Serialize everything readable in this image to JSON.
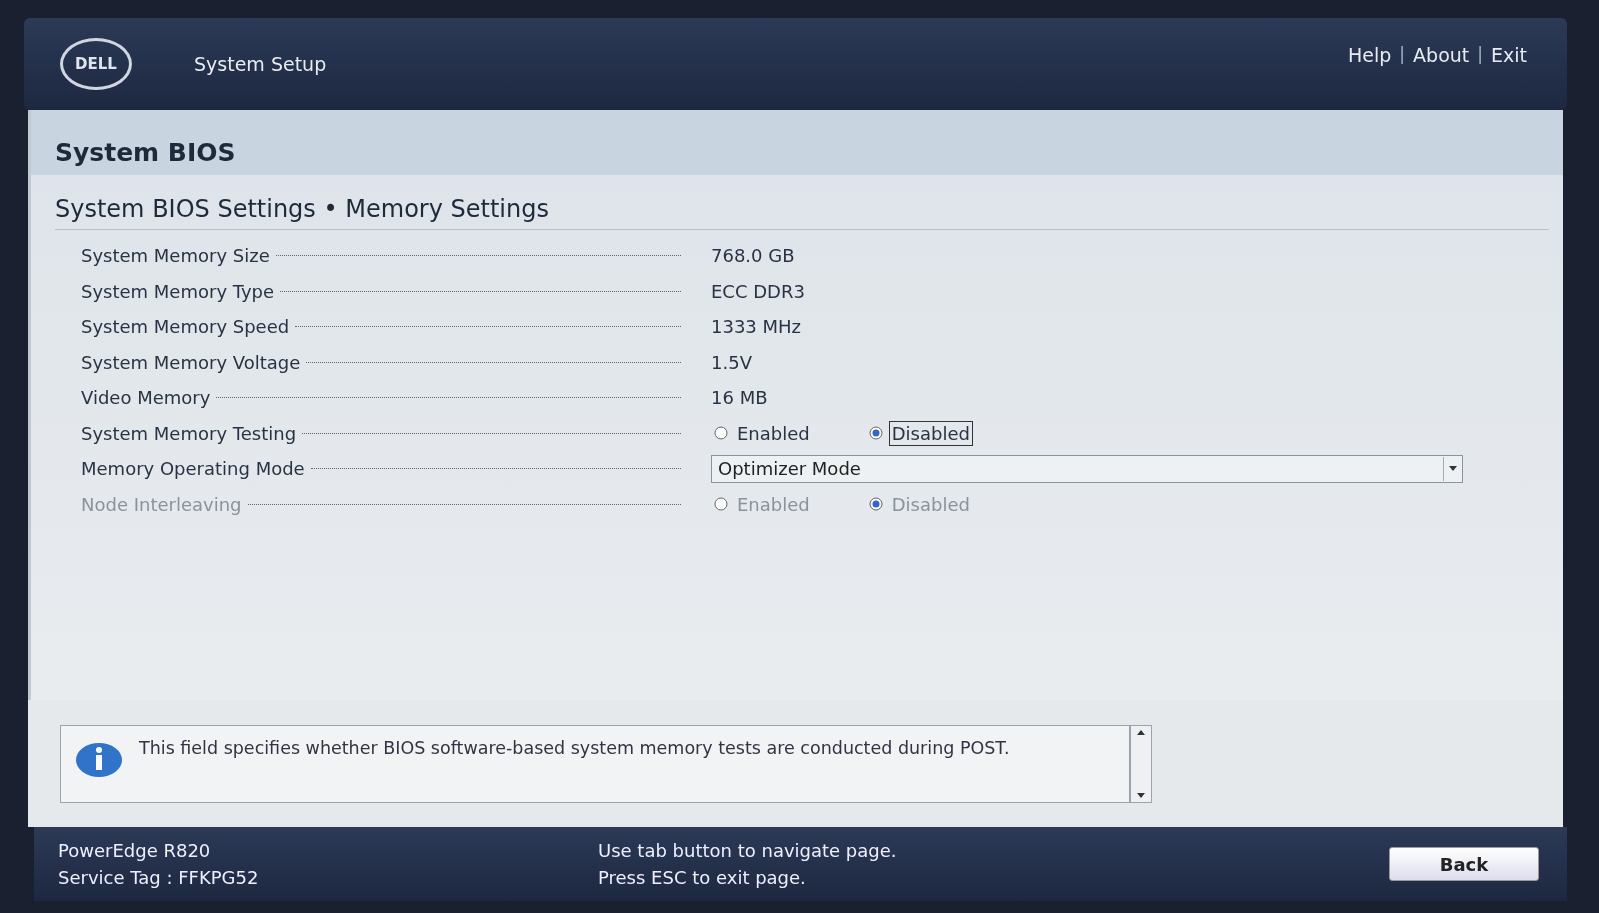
{
  "header": {
    "logo": "DELL",
    "title": "System Setup",
    "items": [
      {
        "kind": "link",
        "text": "Help"
      },
      {
        "kind": "separator",
        "text": "|"
      },
      {
        "kind": "link",
        "text": "About"
      },
      {
        "kind": "separator",
        "text": "|"
      },
      {
        "kind": "link",
        "text": "Exit"
      }
    ]
  },
  "page": {
    "title": "System BIOS",
    "subtitle": "System BIOS Settings • Memory Settings"
  },
  "settings": [
    {
      "kind": "text",
      "label": "System Memory Size",
      "value": "768.0 GB"
    },
    {
      "kind": "text",
      "label": "System Memory Type",
      "value": "ECC DDR3"
    },
    {
      "kind": "text",
      "label": "System Memory Speed",
      "value": "1333 MHz"
    },
    {
      "kind": "text",
      "label": "System Memory Voltage",
      "value": "1.5V"
    },
    {
      "kind": "text",
      "label": "Video Memory",
      "value": "16 MB"
    },
    {
      "kind": "radio",
      "label": "System Memory Testing",
      "disabled": false,
      "options": [
        {
          "label": "Enabled",
          "selected": false,
          "focused": false
        },
        {
          "label": "Disabled",
          "selected": true,
          "focused": true
        }
      ]
    },
    {
      "kind": "dropdown",
      "label": "Memory Operating Mode",
      "value": "Optimizer Mode"
    },
    {
      "kind": "radio",
      "label": "Node Interleaving",
      "disabled": true,
      "options": [
        {
          "label": "Enabled",
          "selected": false,
          "focused": false
        },
        {
          "label": "Disabled",
          "selected": true,
          "focused": false
        }
      ]
    }
  ],
  "help": "This field specifies whether BIOS software-based system memory tests are conducted during POST.",
  "footer": {
    "model": "PowerEdge R820",
    "service_tag": "Service Tag : FFKPG52",
    "hints": [
      "Use tab button to navigate page.",
      "Press ESC to exit page."
    ],
    "back": "Back"
  }
}
